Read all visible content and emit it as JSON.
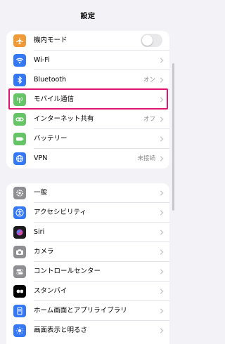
{
  "header": {
    "title": "設定"
  },
  "group1": [
    {
      "id": "airplane",
      "label": "機内モード",
      "icon": "airplane-icon",
      "color": "#f09a37",
      "toggle": false
    },
    {
      "id": "wifi",
      "label": "Wi-Fi",
      "icon": "wifi-icon",
      "color": "#3478f6"
    },
    {
      "id": "bluetooth",
      "label": "Bluetooth",
      "value": "オン",
      "icon": "bluetooth-icon",
      "color": "#3478f6"
    },
    {
      "id": "cellular",
      "label": "モバイル通信",
      "icon": "antenna-icon",
      "color": "#65c466"
    },
    {
      "id": "hotspot",
      "label": "インターネット共有",
      "value": "オフ",
      "icon": "link-icon",
      "color": "#65c466"
    },
    {
      "id": "battery",
      "label": "バッテリー",
      "icon": "battery-icon",
      "color": "#65c466"
    },
    {
      "id": "vpn",
      "label": "VPN",
      "value": "未接続",
      "icon": "globe-icon",
      "color": "#3478f6"
    }
  ],
  "group2": [
    {
      "id": "general",
      "label": "一般",
      "icon": "gear-icon",
      "color": "#8e8e93"
    },
    {
      "id": "accessibility",
      "label": "アクセシビリティ",
      "icon": "accessibility-icon",
      "color": "#3478f6"
    },
    {
      "id": "siri",
      "label": "Siri",
      "icon": "siri-icon",
      "color": "#1c1c1e"
    },
    {
      "id": "camera",
      "label": "カメラ",
      "icon": "camera-icon",
      "color": "#8e8e93"
    },
    {
      "id": "control-center",
      "label": "コントロールセンター",
      "icon": "switches-icon",
      "color": "#8e8e93"
    },
    {
      "id": "standby",
      "label": "スタンバイ",
      "icon": "standby-icon",
      "color": "#000000"
    },
    {
      "id": "home-screen",
      "label": "ホーム画面とアプリライブラリ",
      "icon": "phone-icon",
      "color": "#3478f6"
    },
    {
      "id": "display",
      "label": "画面表示と明るさ",
      "icon": "sun-icon",
      "color": "#3478f6"
    }
  ],
  "highlight_color": "#e0146e"
}
